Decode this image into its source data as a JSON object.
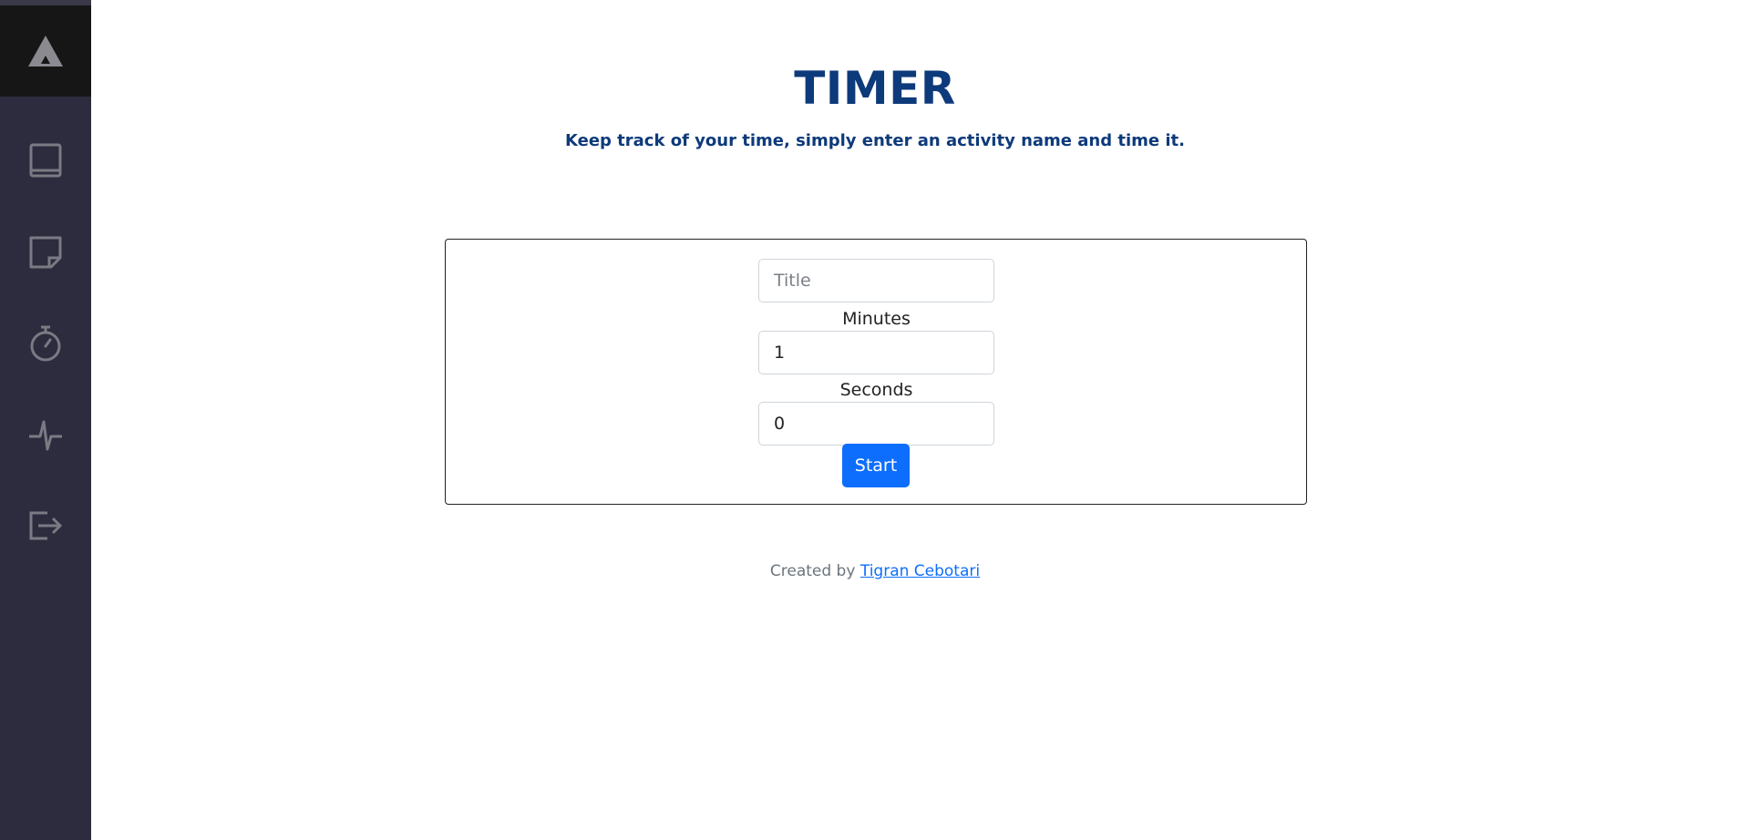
{
  "sidebar": {
    "logo_icon": "triangle-logo-icon",
    "items": [
      {
        "name": "book-icon"
      },
      {
        "name": "sticky-note-icon"
      },
      {
        "name": "stopwatch-icon"
      },
      {
        "name": "activity-pulse-icon"
      },
      {
        "name": "logout-icon"
      }
    ],
    "colors": {
      "background": "#2d2c3e",
      "logo_background": "#161616",
      "icon": "#7a7a84"
    }
  },
  "header": {
    "title": "TIMER",
    "subtitle": "Keep track of your time, simply enter an activity name and time it."
  },
  "form": {
    "title_placeholder": "Title",
    "title_value": "",
    "minutes_label": "Minutes",
    "minutes_value": "1",
    "seconds_label": "Seconds",
    "seconds_value": "0",
    "start_label": "Start"
  },
  "footer": {
    "prefix": "Created by",
    "author_link": "Tigran Cebotari"
  },
  "colors": {
    "title": "#0d3a7a",
    "primary": "#0d6efd"
  }
}
